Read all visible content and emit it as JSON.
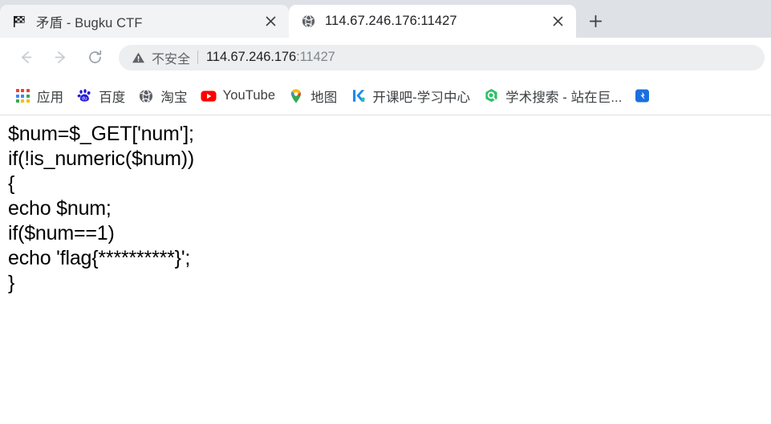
{
  "browser": {
    "tabs": [
      {
        "title": "矛盾 - Bugku CTF",
        "favicon": "checkered-flag-icon",
        "active": false,
        "close_label": "×"
      },
      {
        "title": "114.67.246.176:11427",
        "favicon": "globe-icon",
        "active": true,
        "close_label": "×"
      }
    ],
    "new_tab_label": "+",
    "toolbar": {
      "back_icon": "arrow-left-icon",
      "forward_icon": "arrow-right-icon",
      "reload_icon": "reload-icon",
      "security_icon": "warning-triangle-icon",
      "security_text": "不安全",
      "url_host": "114.67.246.176",
      "url_port": ":11427",
      "url_full": "114.67.246.176:11427"
    },
    "bookmarks": [
      {
        "label": "应用",
        "icon": "apps-grid-icon"
      },
      {
        "label": "百度",
        "icon": "baidu-paw-icon"
      },
      {
        "label": "淘宝",
        "icon": "globe-icon"
      },
      {
        "label": "YouTube",
        "icon": "youtube-play-icon"
      },
      {
        "label": "地图",
        "icon": "google-maps-pin-icon"
      },
      {
        "label": "开课吧-学习中心",
        "icon": "kaikeba-k-icon"
      },
      {
        "label": "学术搜索 - 站在巨...",
        "icon": "green-hexagon-q-icon"
      },
      {
        "label": "",
        "icon": "blue-square-icon"
      }
    ]
  },
  "colors": {
    "tabstrip_bg": "#dee1e6",
    "inactive_tab": "#f1f3f4",
    "active_tab": "#ffffff",
    "omnibox_bg": "#eceef0",
    "text_primary": "#202124",
    "text_secondary": "#5f6368",
    "youtube_red": "#ff0000",
    "baidu_blue": "#2319dc",
    "scholar_green": "#34a853"
  },
  "page": {
    "code_lines": [
      "$num=$_GET['num'];",
      "if(!is_numeric($num))",
      "{",
      "echo $num;",
      "if($num==1)",
      "echo 'flag{**********}';",
      "}"
    ]
  }
}
